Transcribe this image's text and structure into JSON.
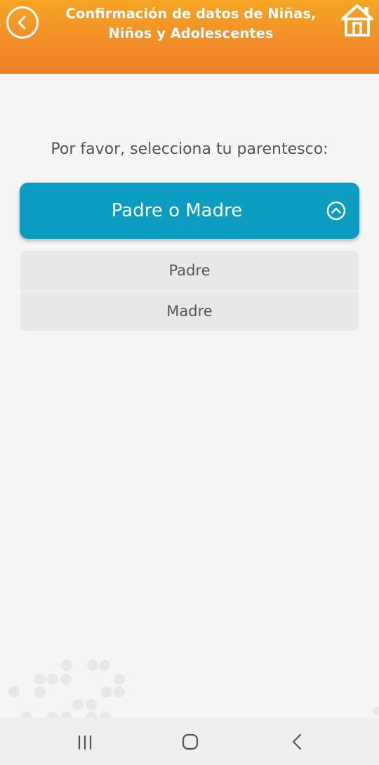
{
  "header": {
    "title": "Confirmación de datos de Niñas, Niños y Adolescentes",
    "back_icon": "chevron-left-circle-icon",
    "home_icon": "home-icon",
    "color": "#f28c28"
  },
  "main": {
    "prompt": "Por favor, selecciona tu parentesco:",
    "select": {
      "selected": "Padre o Madre",
      "icon": "chevron-up-circle-icon",
      "color": "#0a9dc1",
      "options": [
        "Padre",
        "Madre"
      ]
    }
  },
  "navbar": {
    "icons": [
      "recent-apps-icon",
      "home-circle-icon",
      "back-icon"
    ]
  }
}
